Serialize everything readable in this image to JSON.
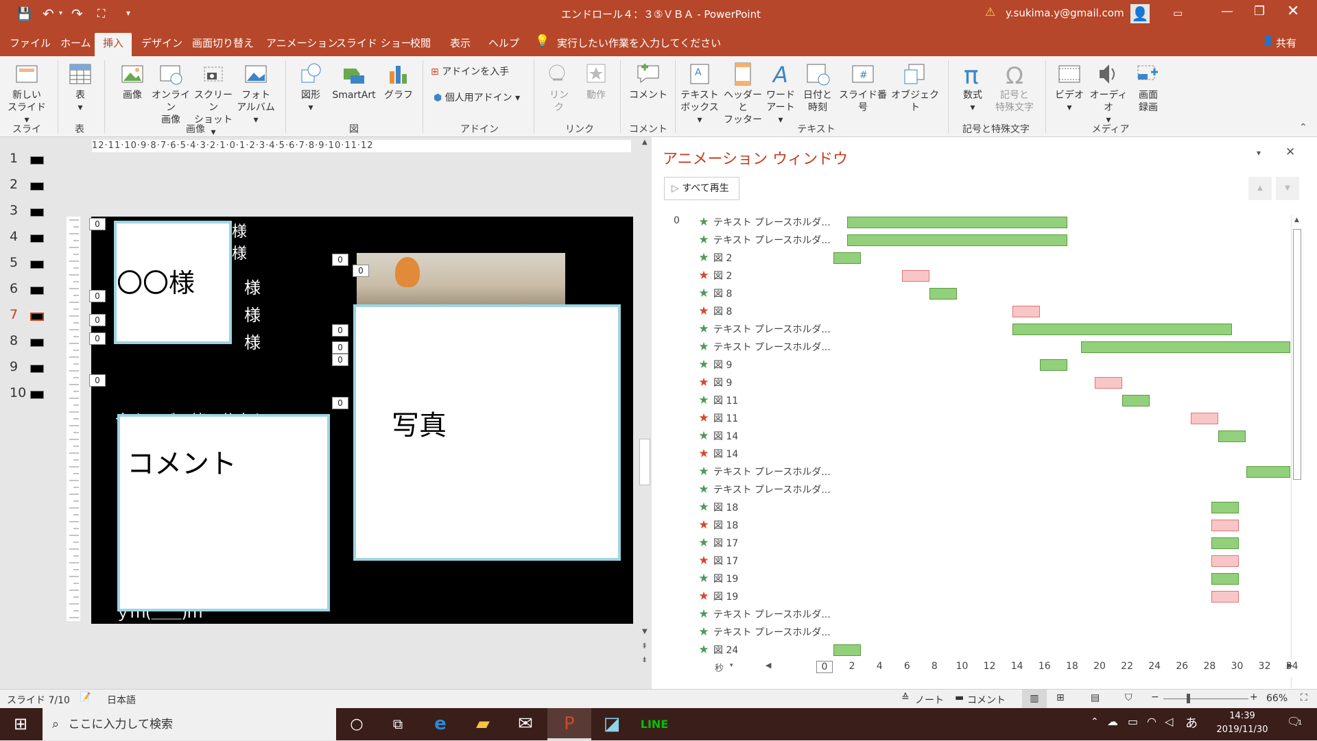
{
  "window": {
    "title": "エンドロール４：３⑤ＶＢＡ  -  PowerPoint",
    "user": "y.sukima.y@gmail.com",
    "warning_icon": "warning-icon"
  },
  "tabs": [
    "ファイル",
    "ホーム",
    "挿入",
    "デザイン",
    "画面切り替え",
    "アニメーション",
    "スライド ショー",
    "校閲",
    "表示",
    "ヘルプ"
  ],
  "tell_me": "実行したい作業を入力してください",
  "share": "共有",
  "ribbon": {
    "new_slide": [
      "新しい",
      "スライド"
    ],
    "table": "表",
    "image": "画像",
    "online_image": [
      "オンライン",
      "画像"
    ],
    "screenshot": [
      "スクリーン",
      "ショット"
    ],
    "photo_album": [
      "フォト",
      "アルバム"
    ],
    "shapes": "図形",
    "smartart": "SmartArt",
    "chart": "グラフ",
    "get_addins": "アドインを入手",
    "my_addins": "個人用アドイン",
    "link": [
      "リン",
      "ク"
    ],
    "action": "動作",
    "comment": "コメント",
    "textbox": [
      "テキスト",
      "ボックス"
    ],
    "header_footer": [
      "ヘッダーと",
      "フッター"
    ],
    "wordart": [
      "ワード",
      "アート"
    ],
    "datetime": [
      "日付と",
      "時刻"
    ],
    "slide_number": "スライド番号",
    "object": "オブジェクト",
    "equation": "数式",
    "symbol": [
      "記号と",
      "特殊文字"
    ],
    "video": "ビデオ",
    "audio": "オーディオ",
    "screen_record": [
      "画面",
      "録画"
    ],
    "groups": {
      "slides": "スライド",
      "tables": "表",
      "images": "画像",
      "illustrations": "図",
      "addins": "アドイン",
      "links": "リンク",
      "comments": "コメント",
      "text": "テキスト",
      "symbols": "記号と特殊文字",
      "media": "メディア"
    }
  },
  "ruler": "12·11·10·9·8·7·6·5·4·3·2·1·0·1·2·3·4·5·6·7·8·9·10·11·12",
  "thumbnails": [
    "1",
    "2",
    "3",
    "4",
    "5",
    "6",
    "7",
    "8",
    "9",
    "10"
  ],
  "slide": {
    "name_box": "〇〇様",
    "photo_box": "写真",
    "comment_box": "コメント",
    "sama_lines": [
      "様",
      "様",
      "様",
      "様",
      "様"
    ],
    "hidden_text": "今までご一緒に仕事を",
    "bottom_text": "ｙｍ(＿＿)ｍ",
    "tags": [
      "0",
      "0",
      "0",
      "0",
      "0",
      "0",
      "0",
      "0",
      "0",
      "0",
      "0"
    ]
  },
  "animation_pane": {
    "title": "アニメーション ウィンドウ",
    "play_all": "すべて再生",
    "start_index": "0",
    "items": [
      {
        "label": "テキスト プレースホルダ...",
        "type": "enter",
        "start": 1,
        "end": 17
      },
      {
        "label": "テキスト プレースホルダ...",
        "type": "enter",
        "start": 1,
        "end": 17
      },
      {
        "label": "図 2",
        "type": "enter",
        "start": 0,
        "end": 2
      },
      {
        "label": "図 2",
        "type": "exit",
        "start": 5,
        "end": 7
      },
      {
        "label": "図 8",
        "type": "enter",
        "start": 7,
        "end": 9
      },
      {
        "label": "図 8",
        "type": "exit",
        "start": 13,
        "end": 15
      },
      {
        "label": "テキスト プレースホルダ...",
        "type": "enter",
        "start": 13,
        "end": 29
      },
      {
        "label": "テキスト プレースホルダ...",
        "type": "enter",
        "start": 18,
        "end": 33.2
      },
      {
        "label": "図 9",
        "type": "enter",
        "start": 15,
        "end": 17
      },
      {
        "label": "図 9",
        "type": "exit",
        "start": 19,
        "end": 21
      },
      {
        "label": "図 11",
        "type": "enter",
        "start": 21,
        "end": 23
      },
      {
        "label": "図 11",
        "type": "exit",
        "start": 26,
        "end": 28
      },
      {
        "label": "図 14",
        "type": "enter",
        "start": 28,
        "end": 30
      },
      {
        "label": "図 14",
        "type": "exit",
        "start": null,
        "end": null
      },
      {
        "label": "テキスト プレースホルダ...",
        "type": "enter",
        "start": 30,
        "end": 33.2
      },
      {
        "label": "テキスト プレースホルダ...",
        "type": "enter",
        "start": null,
        "end": null
      },
      {
        "label": "図 18",
        "type": "enter",
        "start": 27.5,
        "end": 29.5
      },
      {
        "label": "図 18",
        "type": "exit",
        "start": 27.5,
        "end": 29.5
      },
      {
        "label": "図 17",
        "type": "enter",
        "start": 27.5,
        "end": 29.5
      },
      {
        "label": "図 17",
        "type": "exit",
        "start": 27.5,
        "end": 29.5
      },
      {
        "label": "図 19",
        "type": "enter",
        "start": 27.5,
        "end": 29.5
      },
      {
        "label": "図 19",
        "type": "exit",
        "start": 27.5,
        "end": 29.5
      },
      {
        "label": "テキスト プレースホルダ...",
        "type": "enter",
        "start": null,
        "end": null
      },
      {
        "label": "テキスト プレースホルダ...",
        "type": "enter",
        "start": null,
        "end": null
      },
      {
        "label": "図 24",
        "type": "enter",
        "start": 0,
        "end": 2
      }
    ],
    "timeline_unit": "秒",
    "timeline_ticks": [
      "0",
      "2",
      "4",
      "6",
      "8",
      "10",
      "12",
      "14",
      "16",
      "18",
      "20",
      "22",
      "24",
      "26",
      "28",
      "30",
      "32",
      "34"
    ]
  },
  "status": {
    "slide": "スライド 7/10",
    "language": "日本語",
    "notes": "ノート",
    "comments": "コメント",
    "zoom": "66%"
  },
  "taskbar": {
    "search": "ここに入力して検索",
    "time": "14:39",
    "date": "2019/11/30",
    "ime": "あ",
    "notif": "1"
  }
}
